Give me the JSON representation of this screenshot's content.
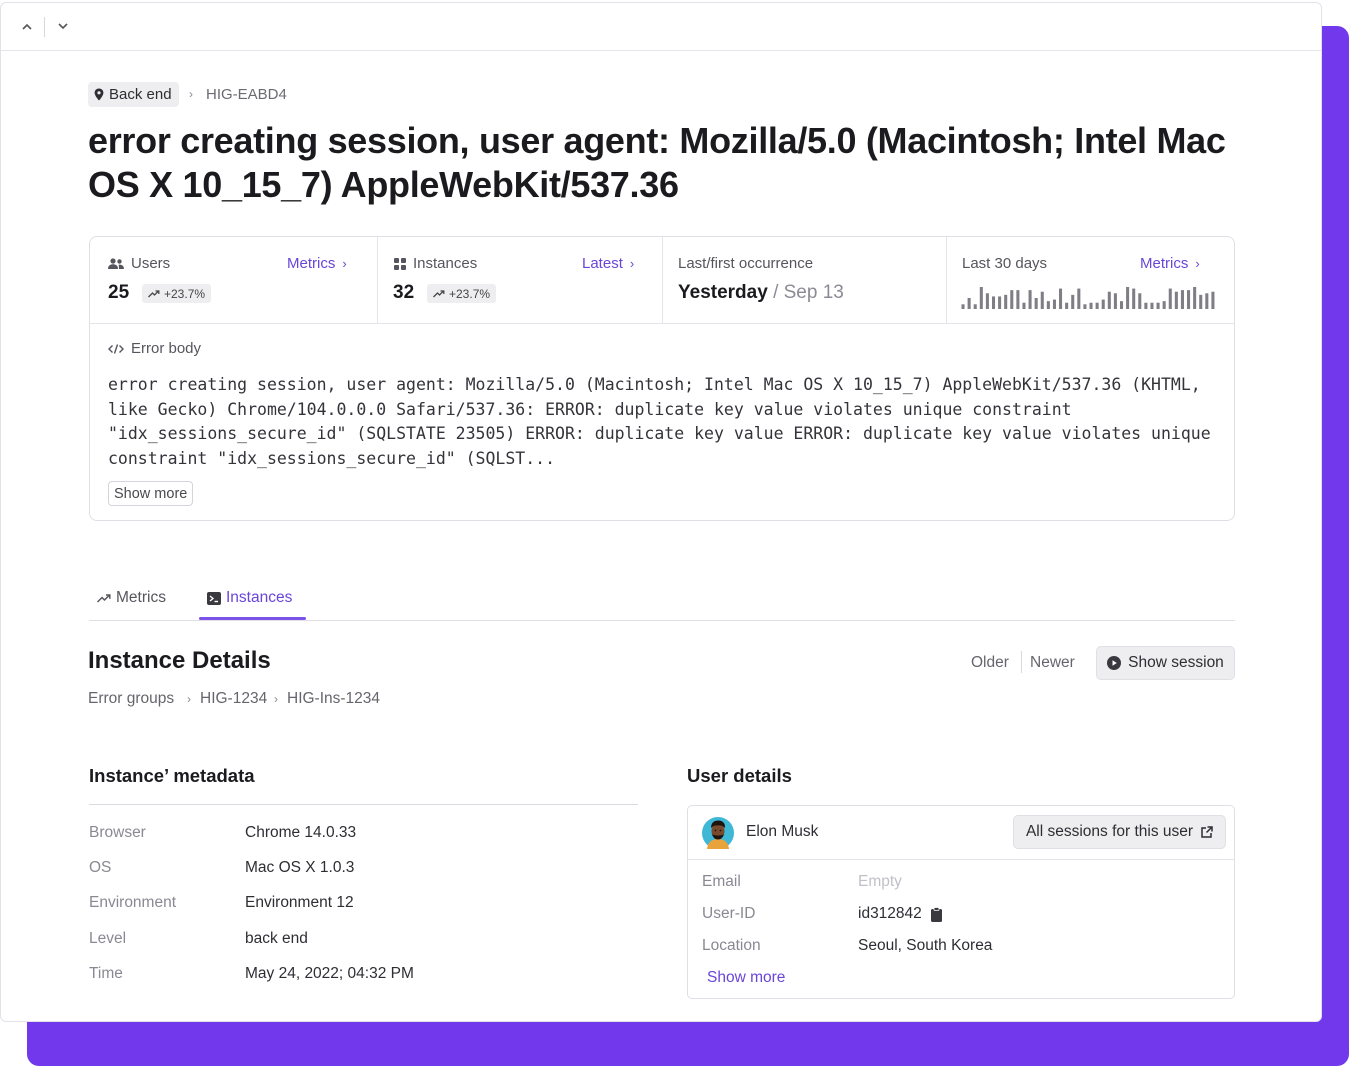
{
  "breadcrumb": {
    "tag": "Back end",
    "id": "HIG-EABD4"
  },
  "title": "error creating session, user agent: Mozilla/5.0 (Macintosh; Intel Mac OS X 10_15_7) AppleWebKit/537.36",
  "stats": {
    "users": {
      "label": "Users",
      "link": "Metrics",
      "value": "25",
      "trend": "+23.7%"
    },
    "instances": {
      "label": "Instances",
      "link": "Latest",
      "value": "32",
      "trend": "+23.7%"
    },
    "occurrence": {
      "label": "Last/first occurrence",
      "last": "Yesterday",
      "first": "/ Sep 13"
    },
    "last30": {
      "label": "Last 30 days",
      "link": "Metrics",
      "bars": [
        3,
        7,
        3,
        14,
        10,
        8,
        8,
        9,
        12,
        12,
        4,
        12,
        7,
        11,
        5,
        6,
        13,
        4,
        9,
        13,
        3,
        4,
        4,
        6,
        11,
        10,
        5,
        14,
        13,
        10,
        4,
        4,
        4,
        5,
        13,
        11,
        12,
        12,
        14,
        9,
        10,
        11
      ]
    }
  },
  "error_body": {
    "label": "Error body",
    "text": "error creating session, user agent: Mozilla/5.0 (Macintosh; Intel Mac OS X 10_15_7) AppleWebKit/537.36 (KHTML, like Gecko) Chrome/104.0.0.0 Safari/537.36: ERROR: duplicate key value violates unique constraint \"idx_sessions_secure_id\" (SQLSTATE 23505) ERROR: duplicate key value ERROR: duplicate key value violates unique constraint \"idx_sessions_secure_id\" (SQLST...",
    "show_more": "Show more"
  },
  "tabs": [
    {
      "label": "Metrics"
    },
    {
      "label": "Instances",
      "active": true
    }
  ],
  "instance": {
    "title": "Instance Details",
    "older": "Older",
    "newer": "Newer",
    "show_session": "Show session",
    "breadcrumb": [
      "Error groups",
      "HIG-1234",
      "HIG-Ins-1234"
    ]
  },
  "metadata": {
    "title": "Instance’ metadata",
    "rows": [
      {
        "key": "Browser",
        "value": "Chrome 14.0.33"
      },
      {
        "key": "OS",
        "value": "Mac OS X 1.0.3"
      },
      {
        "key": "Environment",
        "value": "Environment 12"
      },
      {
        "key": "Level",
        "value": "back end"
      },
      {
        "key": "Time",
        "value": "May 24, 2022; 04:32 PM"
      }
    ]
  },
  "user_details": {
    "title": "User details",
    "name": "Elon Musk",
    "all_sessions": "All sessions for this user",
    "rows": [
      {
        "key": "Email",
        "value": "Empty"
      },
      {
        "key": "User-ID",
        "value": "id312842"
      },
      {
        "key": "Location",
        "value": "Seoul, South Korea"
      }
    ],
    "show_more": "Show more"
  },
  "colors": {
    "accent": "#6a45d9",
    "frame": "#7138ec"
  },
  "icons": [
    "chevron-up-icon",
    "chevron-down-icon",
    "pin-icon",
    "users-icon",
    "grid-icon",
    "code-icon",
    "trend-up-icon",
    "terminal-icon",
    "play-icon",
    "external-link-icon",
    "clipboard-icon"
  ]
}
